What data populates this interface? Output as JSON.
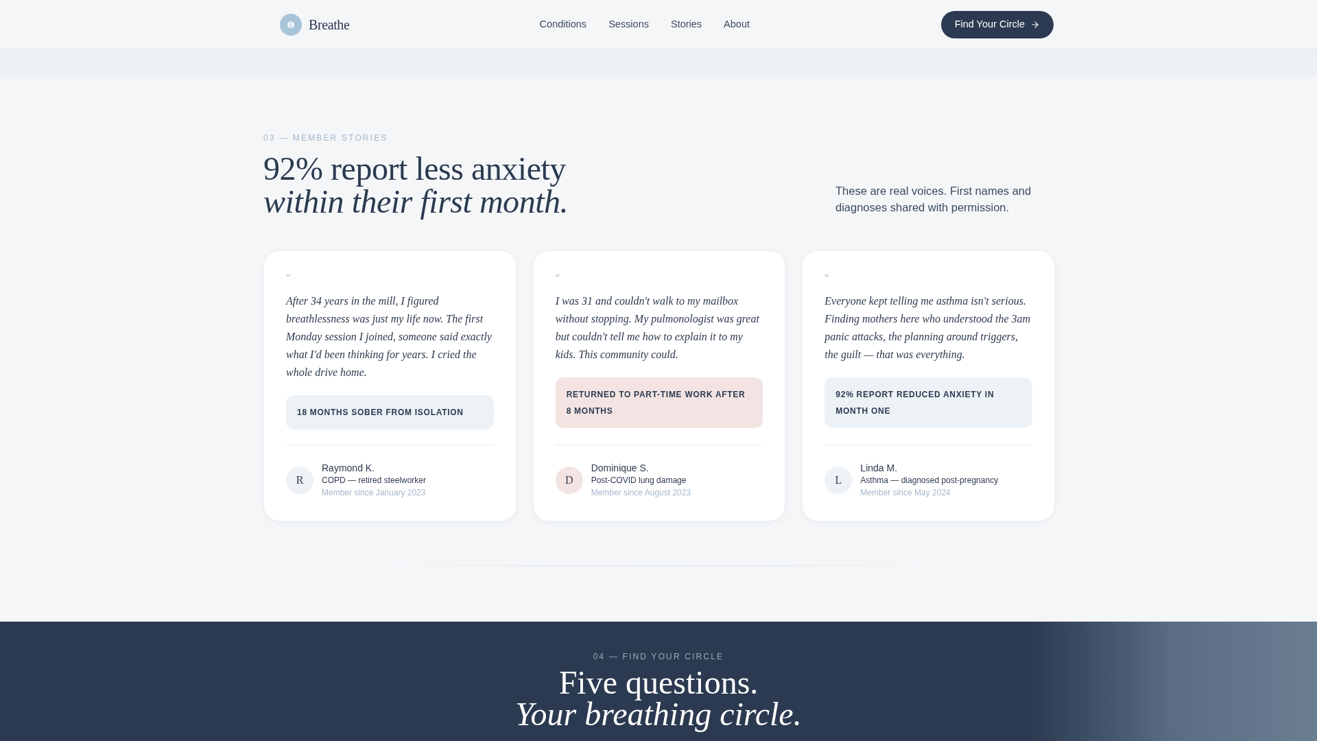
{
  "header": {
    "brand": "Breathe",
    "nav": [
      {
        "label": "Conditions"
      },
      {
        "label": "Sessions"
      },
      {
        "label": "Stories"
      },
      {
        "label": "About"
      }
    ],
    "cta": "Find Your Circle"
  },
  "stories": {
    "eyebrow": "03 — MEMBER STORIES",
    "heading_line1": "92% report less anxiety",
    "heading_line2": "within their first month.",
    "intro": "These are real voices. First names and diagnoses shared with permission.",
    "cards": [
      {
        "quote_mark": "“",
        "quote": "After 34 years in the mill, I figured breathlessness was just my life now. The first Monday session I joined, someone said exactly what I'd been thinking for years. I cried the whole drive home.",
        "tag": "18 MONTHS SOBER FROM ISOLATION",
        "color": "#edf2f7",
        "initial": "R",
        "name": "Raymond K.",
        "condition": "COPD — retired steelworker",
        "since": "Member since January 2023"
      },
      {
        "quote_mark": "“",
        "quote": "I was 31 and couldn't walk to my mailbox without stopping. My pulmonologist was great but couldn't tell me how to explain it to my kids. This community could.",
        "tag": "RETURNED TO PART-TIME WORK AFTER 8 MONTHS",
        "color": "#f3e4e3",
        "initial": "D",
        "name": "Dominique S.",
        "condition": "Post-COVID lung damage",
        "since": "Member since August 2023"
      },
      {
        "quote_mark": "“",
        "quote": "Everyone kept telling me asthma isn't serious. Finding mothers here who understood the 3am panic attacks, the planning around triggers, the guilt — that was everything.",
        "tag": "92% REPORT REDUCED ANXIETY IN MONTH ONE",
        "color": "#edf2f7",
        "initial": "L",
        "name": "Linda M.",
        "condition": "Asthma — diagnosed post-pregnancy",
        "since": "Member since May 2024"
      }
    ]
  },
  "find": {
    "eyebrow": "04 — FIND YOUR CIRCLE",
    "heading_line1": "Five questions.",
    "heading_line2": "Your breathing circle."
  }
}
